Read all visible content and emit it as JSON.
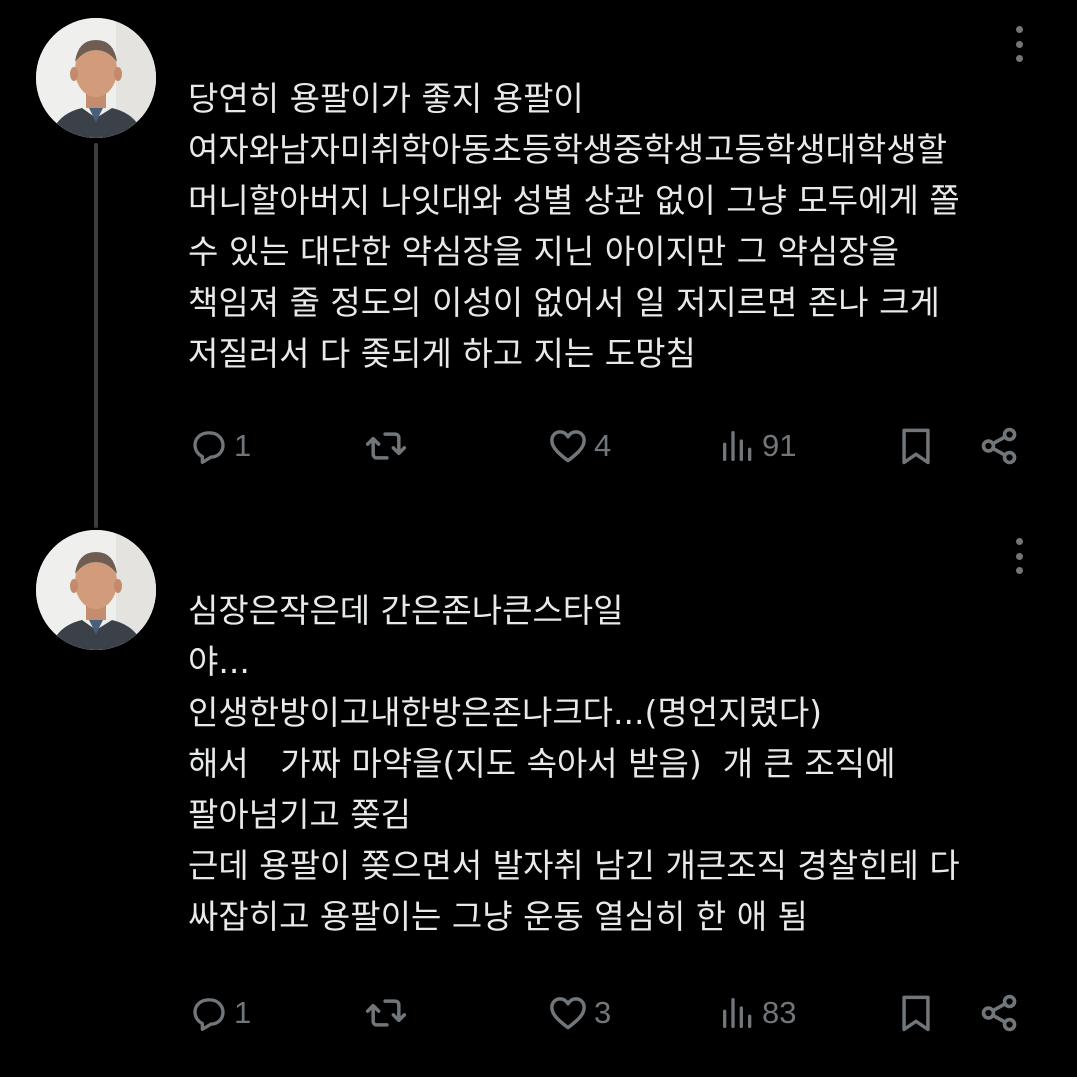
{
  "colors": {
    "background": "#000000",
    "text": "#e7e9ea",
    "icon_gray": "#71767b",
    "thread_line": "#3a3d40"
  },
  "replies": [
    {
      "lines": [
        "당연히 용팔이가 좋지 용팔이",
        "여자와남자미취학아동초등학생중학생고등학생대학생할",
        "머니할아버지 나잇대와 성별 상관 없이 그냥 모두에게 쫄",
        "수 있는 대단한 약심장을 지닌 아이지만 그 약심장을",
        "책임져 줄 정도의 이성이 없어서 일 저지르면 존나 크게",
        "저질러서 다 좆되게 하고 지는 도망침"
      ],
      "actions": {
        "reply_icon": "reply-icon",
        "replies": "1",
        "retweet_icon": "retweet-icon",
        "like_icon": "heart-icon",
        "likes": "4",
        "views_icon": "bar-chart-icon",
        "views": "91",
        "bookmark_icon": "bookmark-icon",
        "share_icon": "share-icon"
      }
    },
    {
      "lines": [
        "심장은작은데 간은존나큰스타일",
        "야...",
        "인생한방이고내한방은존나크다...(명언지렸다)",
        "해서   가짜 마약을(지도 속아서 받음)  개 큰 조직에",
        "팔아넘기고 쫒김",
        "근데 용팔이 쫒으면서 발자취 남긴 개큰조직 경찰힌테 다",
        "싸잡히고 용팔이는 그냥 운동 열심히 한 애 됨"
      ],
      "actions": {
        "reply_icon": "reply-icon",
        "replies": "1",
        "retweet_icon": "retweet-icon",
        "like_icon": "heart-icon",
        "likes": "3",
        "views_icon": "bar-chart-icon",
        "views": "83",
        "bookmark_icon": "bookmark-icon",
        "share_icon": "share-icon"
      }
    }
  ]
}
